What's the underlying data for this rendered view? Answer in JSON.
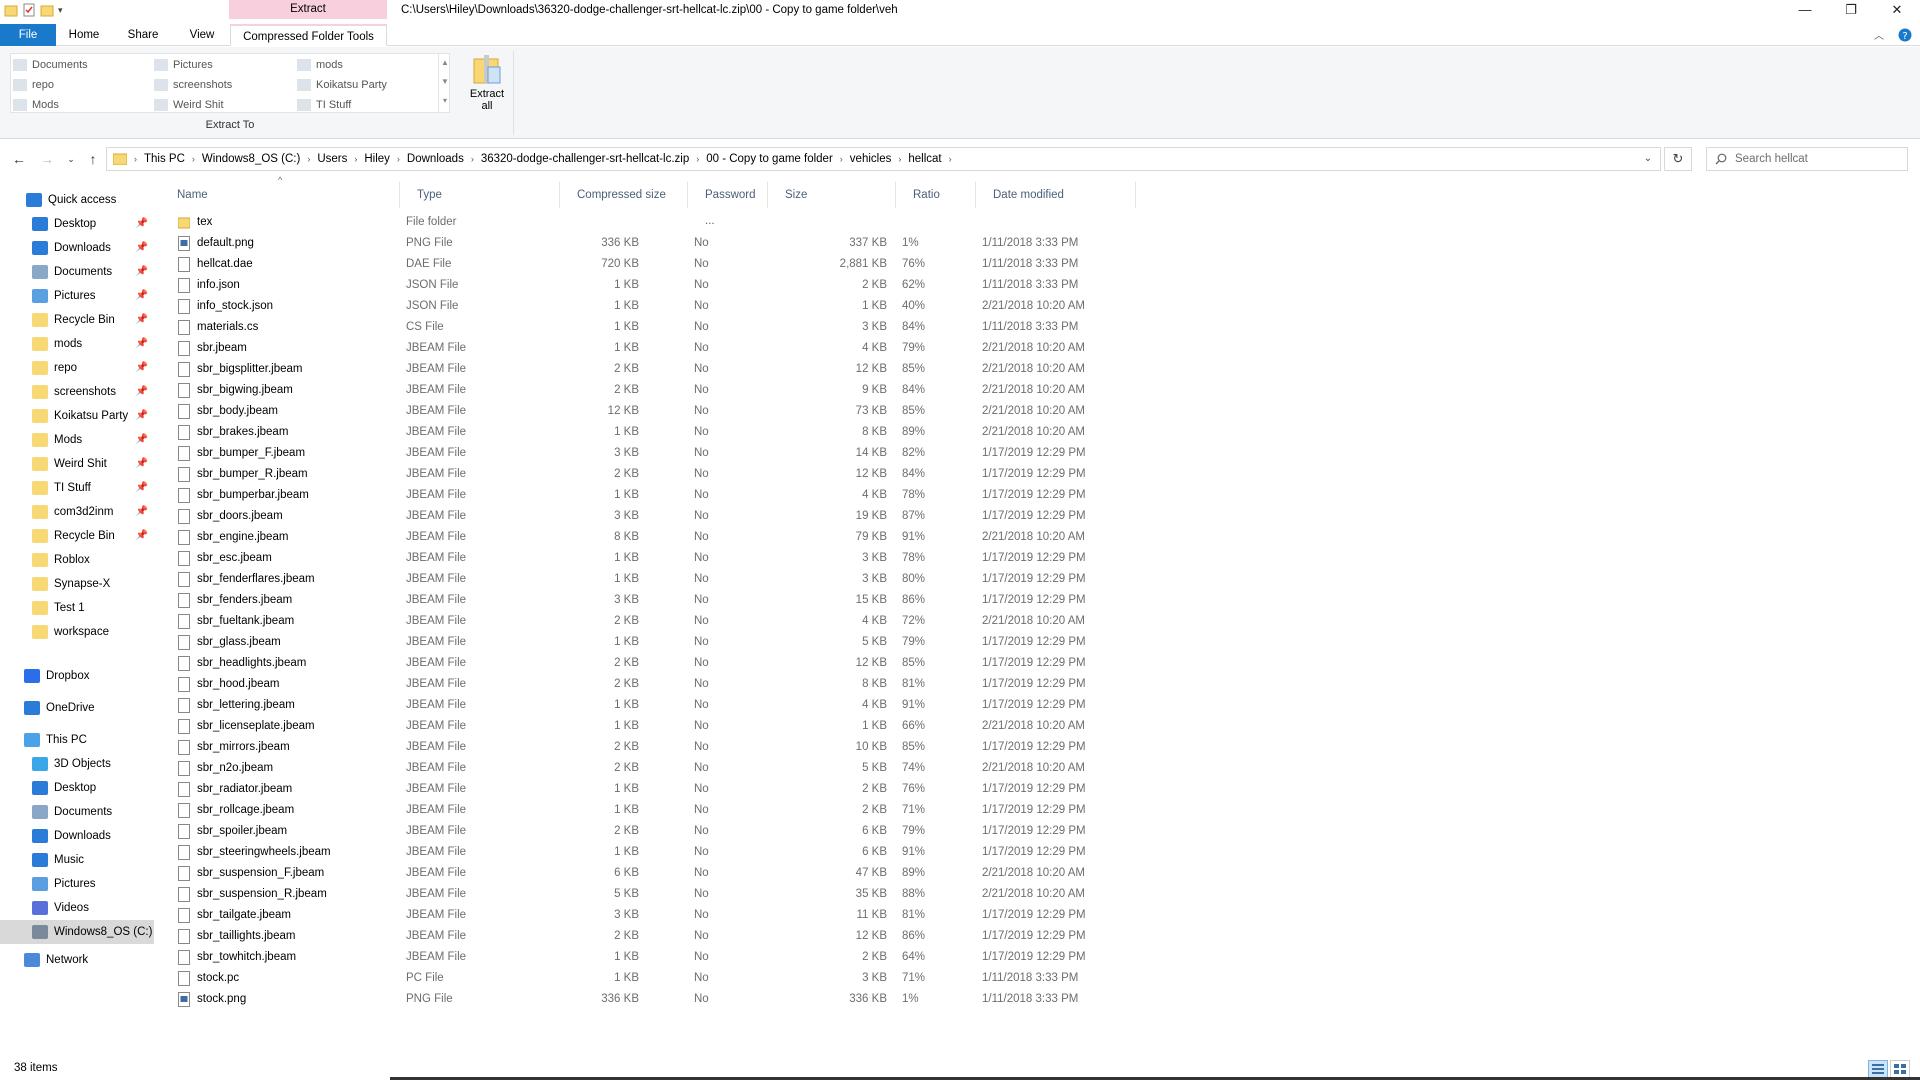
{
  "titlebar": {
    "context_tab": "Extract",
    "path": "C:\\Users\\Hiley\\Downloads\\36320-dodge-challenger-srt-hellcat-lc.zip\\00 - Copy to game folder\\veh",
    "minimize": "—",
    "maximize": "❐",
    "close": "✕"
  },
  "ribbon_tabs": {
    "file": "File",
    "home": "Home",
    "share": "Share",
    "view": "View",
    "compressed": "Compressed Folder Tools"
  },
  "ribbon": {
    "gallery": [
      {
        "label": "Documents"
      },
      {
        "label": "repo"
      },
      {
        "label": "Mods"
      },
      {
        "label": "Pictures"
      },
      {
        "label": "screenshots"
      },
      {
        "label": "Weird Shit"
      },
      {
        "label": "mods"
      },
      {
        "label": "Koikatsu Party"
      },
      {
        "label": "TI Stuff"
      }
    ],
    "extract_to_label": "Extract To",
    "extract_all_line1": "Extract",
    "extract_all_line2": "all"
  },
  "address": {
    "crumbs": [
      "This PC",
      "Windows8_OS (C:)",
      "Users",
      "Hiley",
      "Downloads",
      "36320-dodge-challenger-srt-hellcat-lc.zip",
      "00 - Copy to game folder",
      "vehicles",
      "hellcat"
    ],
    "search_placeholder": "Search hellcat"
  },
  "sidebar": {
    "quick_access": "Quick access",
    "quick_items": [
      {
        "label": "Desktop",
        "icon": "desktop"
      },
      {
        "label": "Downloads",
        "icon": "download"
      },
      {
        "label": "Documents",
        "icon": "document"
      },
      {
        "label": "Pictures",
        "icon": "picture"
      },
      {
        "label": "Recycle Bin",
        "icon": "folder"
      },
      {
        "label": "mods",
        "icon": "folder"
      },
      {
        "label": "repo",
        "icon": "folder"
      },
      {
        "label": "screenshots",
        "icon": "folder"
      },
      {
        "label": "Koikatsu Party",
        "icon": "folder"
      },
      {
        "label": "Mods",
        "icon": "folder"
      },
      {
        "label": "Weird Shit",
        "icon": "folder"
      },
      {
        "label": "TI Stuff",
        "icon": "folder"
      },
      {
        "label": "com3d2inm",
        "icon": "folder"
      },
      {
        "label": "Recycle Bin",
        "icon": "folder"
      },
      {
        "label": "Roblox",
        "icon": "folder"
      },
      {
        "label": "Synapse-X",
        "icon": "folder"
      },
      {
        "label": "Test 1",
        "icon": "folder"
      },
      {
        "label": "workspace",
        "icon": "folder"
      }
    ],
    "dropbox": "Dropbox",
    "onedrive": "OneDrive",
    "this_pc": "This PC",
    "pc_items": [
      {
        "label": "3D Objects",
        "icon": "3d"
      },
      {
        "label": "Desktop",
        "icon": "desktop"
      },
      {
        "label": "Documents",
        "icon": "document"
      },
      {
        "label": "Downloads",
        "icon": "download"
      },
      {
        "label": "Music",
        "icon": "music"
      },
      {
        "label": "Pictures",
        "icon": "picture"
      },
      {
        "label": "Videos",
        "icon": "video"
      },
      {
        "label": "Windows8_OS (C:)",
        "icon": "drive"
      }
    ],
    "network": "Network"
  },
  "columns": {
    "name": "Name",
    "type": "Type",
    "csize": "Compressed size",
    "password": "Password ...",
    "size": "Size",
    "ratio": "Ratio",
    "date": "Date modified"
  },
  "files": [
    {
      "name": "tex",
      "type": "File folder",
      "csize": "",
      "pw": "",
      "size": "",
      "ratio": "",
      "date": "",
      "kind": "folder"
    },
    {
      "name": "default.png",
      "type": "PNG File",
      "csize": "336 KB",
      "pw": "No",
      "size": "337 KB",
      "ratio": "1%",
      "date": "1/11/2018 3:33 PM",
      "kind": "image"
    },
    {
      "name": "hellcat.dae",
      "type": "DAE File",
      "csize": "720 KB",
      "pw": "No",
      "size": "2,881 KB",
      "ratio": "76%",
      "date": "1/11/2018 3:33 PM",
      "kind": "file"
    },
    {
      "name": "info.json",
      "type": "JSON File",
      "csize": "1 KB",
      "pw": "No",
      "size": "2 KB",
      "ratio": "62%",
      "date": "1/11/2018 3:33 PM",
      "kind": "file"
    },
    {
      "name": "info_stock.json",
      "type": "JSON File",
      "csize": "1 KB",
      "pw": "No",
      "size": "1 KB",
      "ratio": "40%",
      "date": "2/21/2018 10:20 AM",
      "kind": "file"
    },
    {
      "name": "materials.cs",
      "type": "CS File",
      "csize": "1 KB",
      "pw": "No",
      "size": "3 KB",
      "ratio": "84%",
      "date": "1/11/2018 3:33 PM",
      "kind": "file"
    },
    {
      "name": "sbr.jbeam",
      "type": "JBEAM File",
      "csize": "1 KB",
      "pw": "No",
      "size": "4 KB",
      "ratio": "79%",
      "date": "2/21/2018 10:20 AM",
      "kind": "file"
    },
    {
      "name": "sbr_bigsplitter.jbeam",
      "type": "JBEAM File",
      "csize": "2 KB",
      "pw": "No",
      "size": "12 KB",
      "ratio": "85%",
      "date": "2/21/2018 10:20 AM",
      "kind": "file"
    },
    {
      "name": "sbr_bigwing.jbeam",
      "type": "JBEAM File",
      "csize": "2 KB",
      "pw": "No",
      "size": "9 KB",
      "ratio": "84%",
      "date": "2/21/2018 10:20 AM",
      "kind": "file"
    },
    {
      "name": "sbr_body.jbeam",
      "type": "JBEAM File",
      "csize": "12 KB",
      "pw": "No",
      "size": "73 KB",
      "ratio": "85%",
      "date": "2/21/2018 10:20 AM",
      "kind": "file"
    },
    {
      "name": "sbr_brakes.jbeam",
      "type": "JBEAM File",
      "csize": "1 KB",
      "pw": "No",
      "size": "8 KB",
      "ratio": "89%",
      "date": "2/21/2018 10:20 AM",
      "kind": "file"
    },
    {
      "name": "sbr_bumper_F.jbeam",
      "type": "JBEAM File",
      "csize": "3 KB",
      "pw": "No",
      "size": "14 KB",
      "ratio": "82%",
      "date": "1/17/2019 12:29 PM",
      "kind": "file"
    },
    {
      "name": "sbr_bumper_R.jbeam",
      "type": "JBEAM File",
      "csize": "2 KB",
      "pw": "No",
      "size": "12 KB",
      "ratio": "84%",
      "date": "1/17/2019 12:29 PM",
      "kind": "file"
    },
    {
      "name": "sbr_bumperbar.jbeam",
      "type": "JBEAM File",
      "csize": "1 KB",
      "pw": "No",
      "size": "4 KB",
      "ratio": "78%",
      "date": "1/17/2019 12:29 PM",
      "kind": "file"
    },
    {
      "name": "sbr_doors.jbeam",
      "type": "JBEAM File",
      "csize": "3 KB",
      "pw": "No",
      "size": "19 KB",
      "ratio": "87%",
      "date": "1/17/2019 12:29 PM",
      "kind": "file"
    },
    {
      "name": "sbr_engine.jbeam",
      "type": "JBEAM File",
      "csize": "8 KB",
      "pw": "No",
      "size": "79 KB",
      "ratio": "91%",
      "date": "2/21/2018 10:20 AM",
      "kind": "file"
    },
    {
      "name": "sbr_esc.jbeam",
      "type": "JBEAM File",
      "csize": "1 KB",
      "pw": "No",
      "size": "3 KB",
      "ratio": "78%",
      "date": "1/17/2019 12:29 PM",
      "kind": "file"
    },
    {
      "name": "sbr_fenderflares.jbeam",
      "type": "JBEAM File",
      "csize": "1 KB",
      "pw": "No",
      "size": "3 KB",
      "ratio": "80%",
      "date": "1/17/2019 12:29 PM",
      "kind": "file"
    },
    {
      "name": "sbr_fenders.jbeam",
      "type": "JBEAM File",
      "csize": "3 KB",
      "pw": "No",
      "size": "15 KB",
      "ratio": "86%",
      "date": "1/17/2019 12:29 PM",
      "kind": "file"
    },
    {
      "name": "sbr_fueltank.jbeam",
      "type": "JBEAM File",
      "csize": "2 KB",
      "pw": "No",
      "size": "4 KB",
      "ratio": "72%",
      "date": "2/21/2018 10:20 AM",
      "kind": "file"
    },
    {
      "name": "sbr_glass.jbeam",
      "type": "JBEAM File",
      "csize": "1 KB",
      "pw": "No",
      "size": "5 KB",
      "ratio": "79%",
      "date": "1/17/2019 12:29 PM",
      "kind": "file"
    },
    {
      "name": "sbr_headlights.jbeam",
      "type": "JBEAM File",
      "csize": "2 KB",
      "pw": "No",
      "size": "12 KB",
      "ratio": "85%",
      "date": "1/17/2019 12:29 PM",
      "kind": "file"
    },
    {
      "name": "sbr_hood.jbeam",
      "type": "JBEAM File",
      "csize": "2 KB",
      "pw": "No",
      "size": "8 KB",
      "ratio": "81%",
      "date": "1/17/2019 12:29 PM",
      "kind": "file"
    },
    {
      "name": "sbr_lettering.jbeam",
      "type": "JBEAM File",
      "csize": "1 KB",
      "pw": "No",
      "size": "4 KB",
      "ratio": "91%",
      "date": "1/17/2019 12:29 PM",
      "kind": "file"
    },
    {
      "name": "sbr_licenseplate.jbeam",
      "type": "JBEAM File",
      "csize": "1 KB",
      "pw": "No",
      "size": "1 KB",
      "ratio": "66%",
      "date": "2/21/2018 10:20 AM",
      "kind": "file"
    },
    {
      "name": "sbr_mirrors.jbeam",
      "type": "JBEAM File",
      "csize": "2 KB",
      "pw": "No",
      "size": "10 KB",
      "ratio": "85%",
      "date": "1/17/2019 12:29 PM",
      "kind": "file"
    },
    {
      "name": "sbr_n2o.jbeam",
      "type": "JBEAM File",
      "csize": "2 KB",
      "pw": "No",
      "size": "5 KB",
      "ratio": "74%",
      "date": "2/21/2018 10:20 AM",
      "kind": "file"
    },
    {
      "name": "sbr_radiator.jbeam",
      "type": "JBEAM File",
      "csize": "1 KB",
      "pw": "No",
      "size": "2 KB",
      "ratio": "76%",
      "date": "1/17/2019 12:29 PM",
      "kind": "file"
    },
    {
      "name": "sbr_rollcage.jbeam",
      "type": "JBEAM File",
      "csize": "1 KB",
      "pw": "No",
      "size": "2 KB",
      "ratio": "71%",
      "date": "1/17/2019 12:29 PM",
      "kind": "file"
    },
    {
      "name": "sbr_spoiler.jbeam",
      "type": "JBEAM File",
      "csize": "2 KB",
      "pw": "No",
      "size": "6 KB",
      "ratio": "79%",
      "date": "1/17/2019 12:29 PM",
      "kind": "file"
    },
    {
      "name": "sbr_steeringwheels.jbeam",
      "type": "JBEAM File",
      "csize": "1 KB",
      "pw": "No",
      "size": "6 KB",
      "ratio": "91%",
      "date": "1/17/2019 12:29 PM",
      "kind": "file"
    },
    {
      "name": "sbr_suspension_F.jbeam",
      "type": "JBEAM File",
      "csize": "6 KB",
      "pw": "No",
      "size": "47 KB",
      "ratio": "89%",
      "date": "2/21/2018 10:20 AM",
      "kind": "file"
    },
    {
      "name": "sbr_suspension_R.jbeam",
      "type": "JBEAM File",
      "csize": "5 KB",
      "pw": "No",
      "size": "35 KB",
      "ratio": "88%",
      "date": "2/21/2018 10:20 AM",
      "kind": "file"
    },
    {
      "name": "sbr_tailgate.jbeam",
      "type": "JBEAM File",
      "csize": "3 KB",
      "pw": "No",
      "size": "11 KB",
      "ratio": "81%",
      "date": "1/17/2019 12:29 PM",
      "kind": "file"
    },
    {
      "name": "sbr_taillights.jbeam",
      "type": "JBEAM File",
      "csize": "2 KB",
      "pw": "No",
      "size": "12 KB",
      "ratio": "86%",
      "date": "1/17/2019 12:29 PM",
      "kind": "file"
    },
    {
      "name": "sbr_towhitch.jbeam",
      "type": "JBEAM File",
      "csize": "1 KB",
      "pw": "No",
      "size": "2 KB",
      "ratio": "64%",
      "date": "1/17/2019 12:29 PM",
      "kind": "file"
    },
    {
      "name": "stock.pc",
      "type": "PC File",
      "csize": "1 KB",
      "pw": "No",
      "size": "3 KB",
      "ratio": "71%",
      "date": "1/11/2018 3:33 PM",
      "kind": "file"
    },
    {
      "name": "stock.png",
      "type": "PNG File",
      "csize": "336 KB",
      "pw": "No",
      "size": "336 KB",
      "ratio": "1%",
      "date": "1/11/2018 3:33 PM",
      "kind": "image"
    }
  ],
  "status": {
    "item_count": "38 items"
  },
  "colors": {
    "accent": "#1979ca",
    "context": "#f7cfdd",
    "folder": "#f8d775",
    "header_text": "#4c607a"
  }
}
